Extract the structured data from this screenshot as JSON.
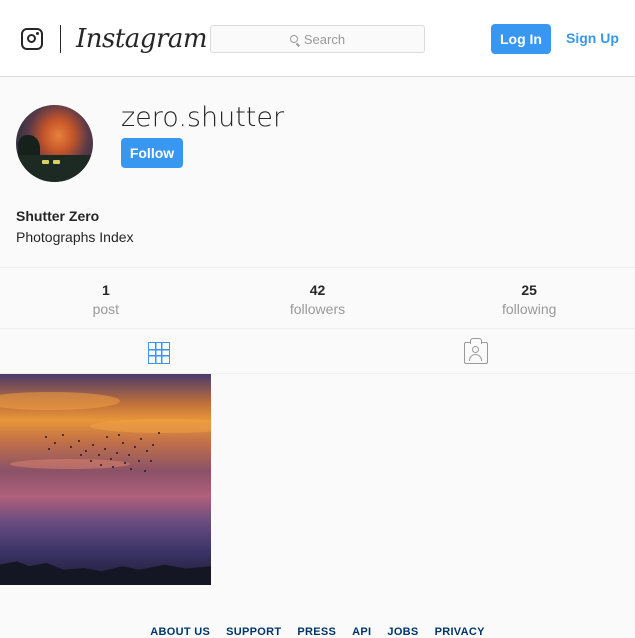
{
  "header": {
    "brand": "Instagram",
    "search_placeholder": "Search",
    "login_label": "Log In",
    "signup_label": "Sign Up",
    "accent_color": "#3897f0"
  },
  "profile": {
    "username": "zero.shutter",
    "follow_label": "Follow",
    "full_name": "Shutter Zero",
    "bio": "Photographs Index"
  },
  "stats": [
    {
      "value": "1",
      "label": "post"
    },
    {
      "value": "42",
      "label": "followers"
    },
    {
      "value": "25",
      "label": "following"
    }
  ],
  "tabs": [
    {
      "icon": "grid-icon",
      "active": true
    },
    {
      "icon": "tagged-photo-icon",
      "active": false
    }
  ],
  "posts": [
    {
      "description_icon": "sunset-photo"
    }
  ],
  "footer": {
    "links": [
      "ABOUT US",
      "SUPPORT",
      "PRESS",
      "API",
      "JOBS",
      "PRIVACY"
    ]
  }
}
